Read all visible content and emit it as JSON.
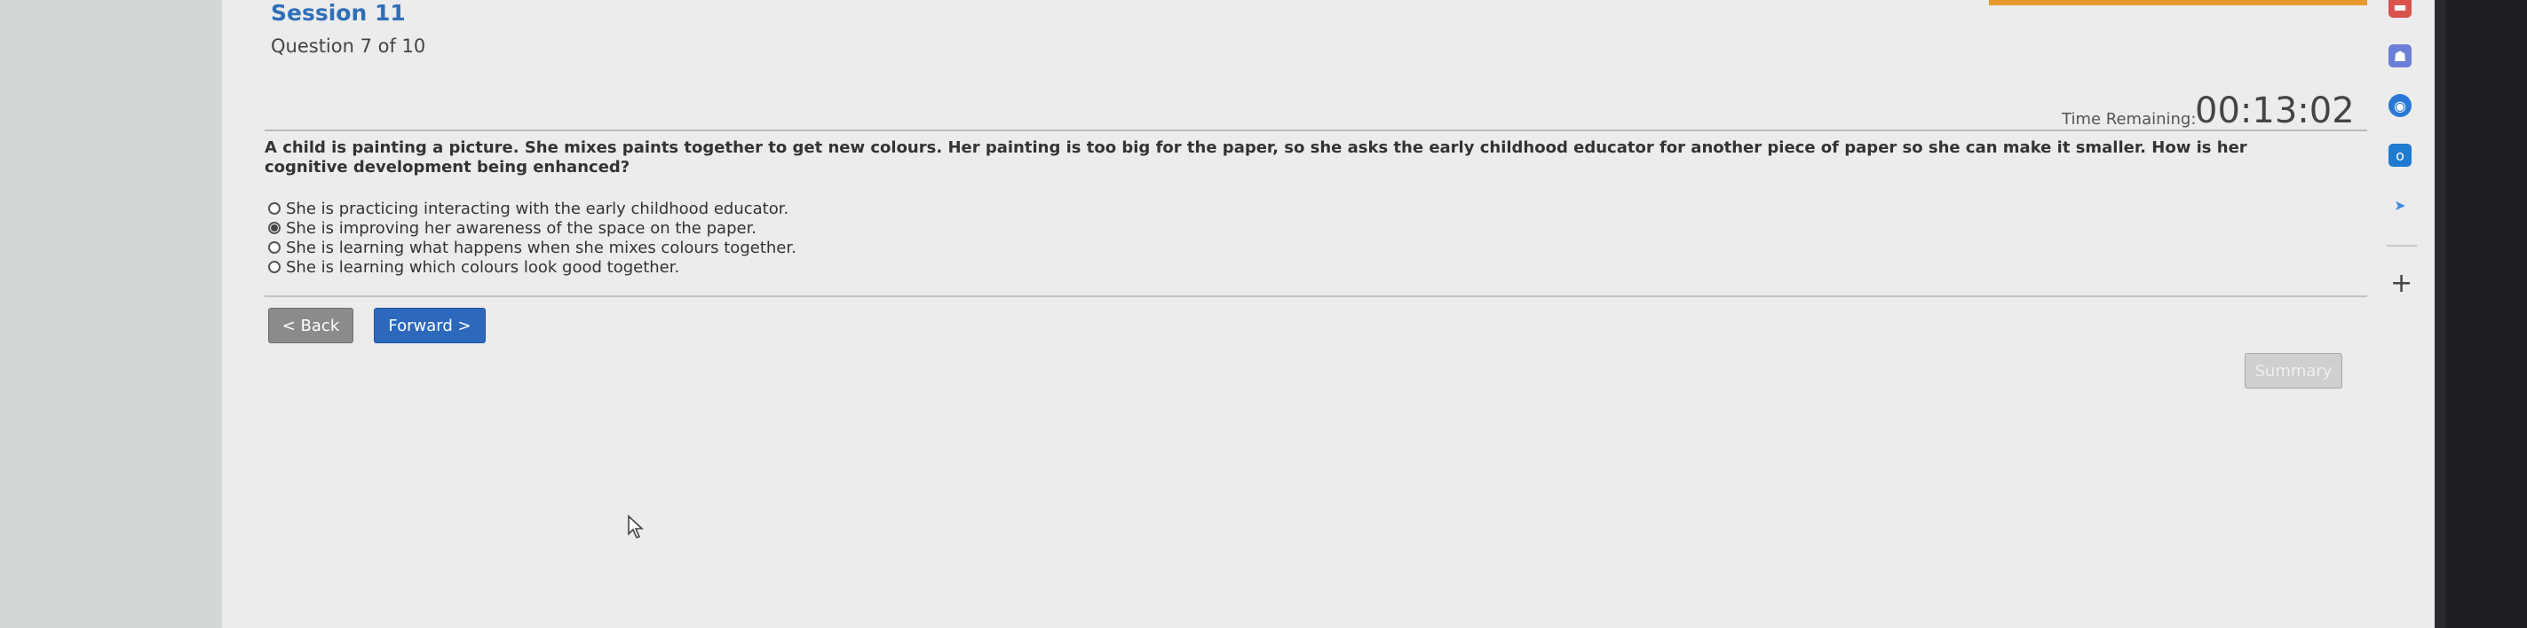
{
  "session": {
    "title": "Session 11"
  },
  "question": {
    "counter": "Question 7 of 10",
    "text": "A child is painting a picture. She mixes paints together to get new colours. Her painting is too big for the paper, so she asks the early childhood educator for another piece of paper so she can make it smaller. How is her cognitive development being enhanced?",
    "options": [
      {
        "label": "She is practicing interacting with the early childhood educator.",
        "selected": false
      },
      {
        "label": "She is improving her awareness of the space on the paper.",
        "selected": true
      },
      {
        "label": "She is learning what happens when she mixes colours together.",
        "selected": false
      },
      {
        "label": "She is learning which colours look good together.",
        "selected": false
      }
    ]
  },
  "timer": {
    "label": "Time Remaining:",
    "value": "00:13:02"
  },
  "nav": {
    "back_label": "< Back",
    "forward_label": "Forward >",
    "summary_label": "Summary"
  },
  "colors": {
    "accent": "#2c69bd",
    "session_title": "#2f6fb7",
    "top_bar": "#e79a2a"
  },
  "sidebar_icons": [
    "app-icon-red",
    "people-icon",
    "browser-icon",
    "outlook-icon",
    "send-icon",
    "add-icon"
  ]
}
